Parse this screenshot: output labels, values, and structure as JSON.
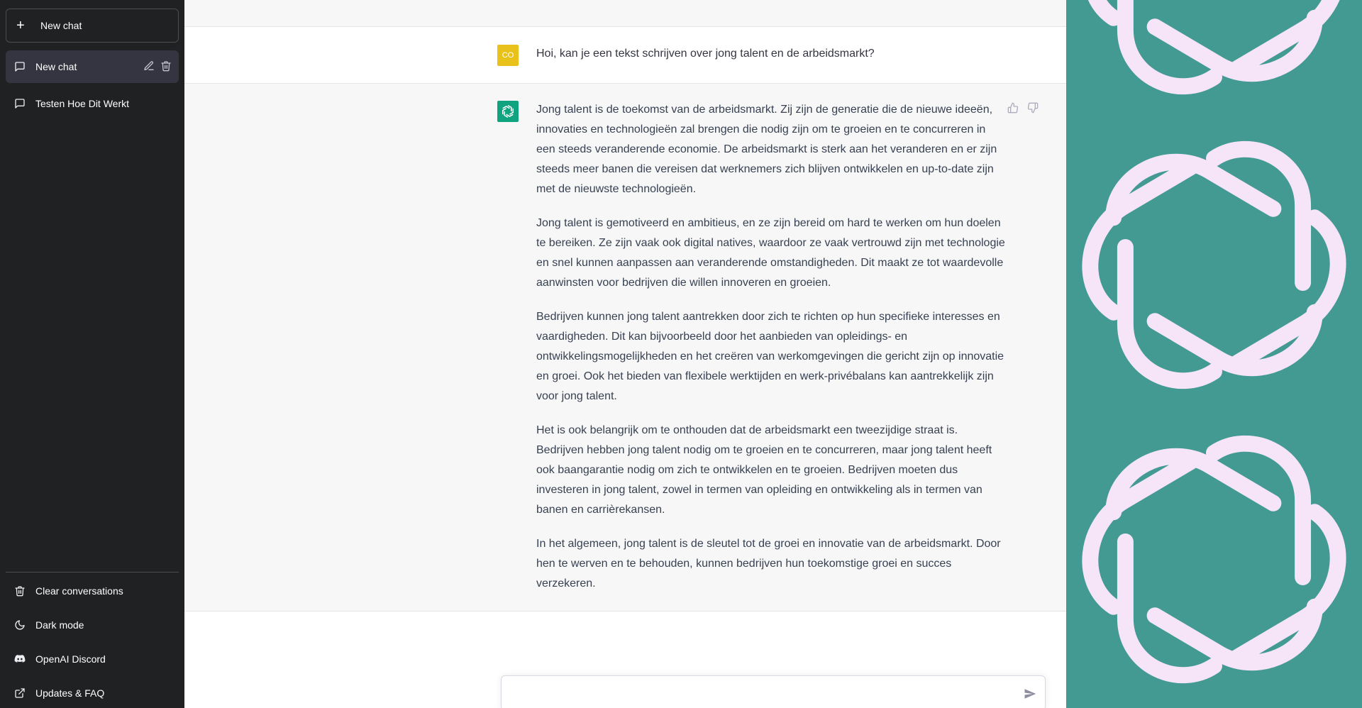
{
  "sidebar": {
    "new_chat_label": "New chat",
    "chats": [
      {
        "label": "New chat"
      },
      {
        "label": "Testen Hoe Dit Werkt"
      }
    ],
    "bottom": [
      {
        "label": "Clear conversations",
        "icon": "trash-icon"
      },
      {
        "label": "Dark mode",
        "icon": "moon-icon"
      },
      {
        "label": "OpenAI Discord",
        "icon": "discord-icon"
      },
      {
        "label": "Updates & FAQ",
        "icon": "external-link-icon"
      }
    ]
  },
  "conversation": {
    "user_initials": "CO",
    "user_message": "Hoi, kan je een tekst schrijven over jong talent en de arbeidsmarkt?",
    "assistant_paragraphs": [
      "Jong talent is de toekomst van de arbeidsmarkt. Zij zijn de generatie die de nieuwe ideeën, innovaties en technologieën zal brengen die nodig zijn om te groeien en te concurreren in een steeds veranderende economie. De arbeidsmarkt is sterk aan het veranderen en er zijn steeds meer banen die vereisen dat werknemers zich blijven ontwikkelen en up-to-date zijn met de nieuwste technologieën.",
      "Jong talent is gemotiveerd en ambitieus, en ze zijn bereid om hard te werken om hun doelen te bereiken. Ze zijn vaak ook digital natives, waardoor ze vaak vertrouwd zijn met technologie en snel kunnen aanpassen aan veranderende omstandigheden. Dit maakt ze tot waardevolle aanwinsten voor bedrijven die willen innoveren en groeien.",
      "Bedrijven kunnen jong talent aantrekken door zich te richten op hun specifieke interesses en vaardigheden. Dit kan bijvoorbeeld door het aanbieden van opleidings- en ontwikkelingsmogelijkheden en het creëren van werkomgevingen die gericht zijn op innovatie en groei. Ook het bieden van flexibele werktijden en werk-privébalans kan aantrekkelijk zijn voor jong talent.",
      "Het is ook belangrijk om te onthouden dat de arbeidsmarkt een tweezijdige straat is. Bedrijven hebben jong talent nodig om te groeien en te concurreren, maar jong talent heeft ook baangarantie nodig om zich te ontwikkelen en te groeien. Bedrijven moeten dus investeren in jong talent, zowel in termen van opleiding en ontwikkeling als in termen van banen en carrièrekansen.",
      "In het algemeen, jong talent is de sleutel tot de groei en innovatie van de arbeidsmarkt. Door hen te werven en te behouden, kunnen bedrijven hun toekomstige groei en succes verzekeren."
    ]
  },
  "input": {
    "value": "",
    "placeholder": ""
  },
  "colors": {
    "sidebar_bg": "#202123",
    "accent": "#10a37f",
    "user_avatar": "#e8c21b",
    "decor_bg": "#429a93",
    "decor_logo": "#f6e4f8"
  }
}
